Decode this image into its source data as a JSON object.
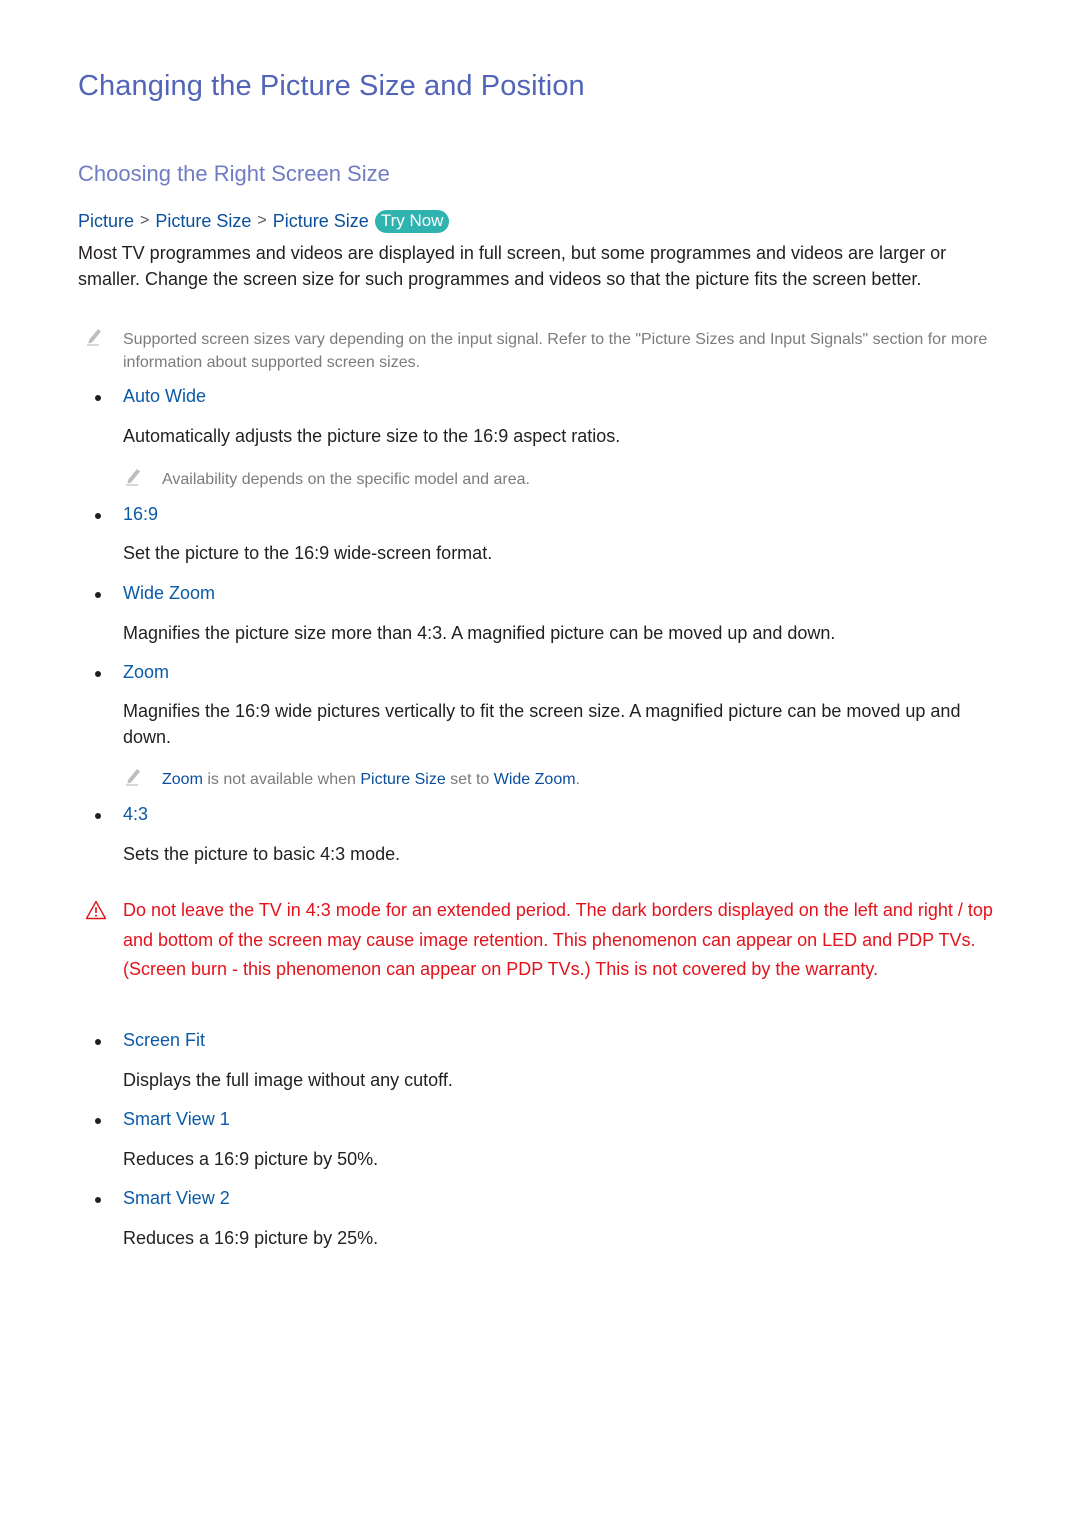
{
  "page": {
    "title": "Changing the Picture Size and Position",
    "section_title": "Choosing the Right Screen Size",
    "breadcrumb": {
      "items": [
        "Picture",
        "Picture Size",
        "Picture Size"
      ],
      "separator_icon": "chevron-right-icon",
      "try_now_label": "Try Now"
    },
    "intro": "Most TV programmes and videos are displayed in full screen, but some programmes and videos are larger or smaller. Change the screen size for such programmes and videos so that the picture fits the screen better.",
    "note_supported": "Supported screen sizes vary depending on the input signal. Refer to the \"Picture Sizes and Input Signals\" section for more information about supported screen sizes.",
    "options": [
      {
        "label": "Auto Wide",
        "description": "Automatically adjusts the picture size to the 16:9 aspect ratios.",
        "note": "Availability depends on the specific model and area."
      },
      {
        "label": "16:9",
        "description": "Set the picture to the 16:9 wide-screen format."
      },
      {
        "label": "Wide Zoom",
        "description": "Magnifies the picture size more than 4:3. A magnified picture can be moved up and down."
      },
      {
        "label": "Zoom",
        "description": "Magnifies the 16:9 wide pictures vertically to fit the screen size. A magnified picture can be moved up and down.",
        "note_parts": {
          "a": "Zoom",
          "b": " is not available when ",
          "c": "Picture Size",
          "d": " set to ",
          "e": "Wide Zoom",
          "f": "."
        }
      },
      {
        "label": "4:3",
        "description": "Sets the picture to basic 4:3 mode."
      },
      {
        "label": "Screen Fit",
        "description": "Displays the full image without any cutoff."
      },
      {
        "label": "Smart View 1",
        "description": "Reduces a 16:9 picture by 50%."
      },
      {
        "label": "Smart View 2",
        "description": "Reduces a 16:9 picture by 25%."
      }
    ],
    "warning": "Do not leave the TV in 4:3 mode for an extended period. The dark borders displayed on the left and right / top and bottom of the screen may cause image retention. This phenomenon can appear on LED and PDP TVs. (Screen burn - this phenomenon can appear on PDP TVs.) This is not covered by the warranty.",
    "colors": {
      "title": "#5264b8",
      "subtitle": "#6f7cc2",
      "link": "#0b5aa8",
      "try_now_bg": "#2fb3ae",
      "warning": "#e4121b",
      "note": "#7b7b7b"
    }
  }
}
